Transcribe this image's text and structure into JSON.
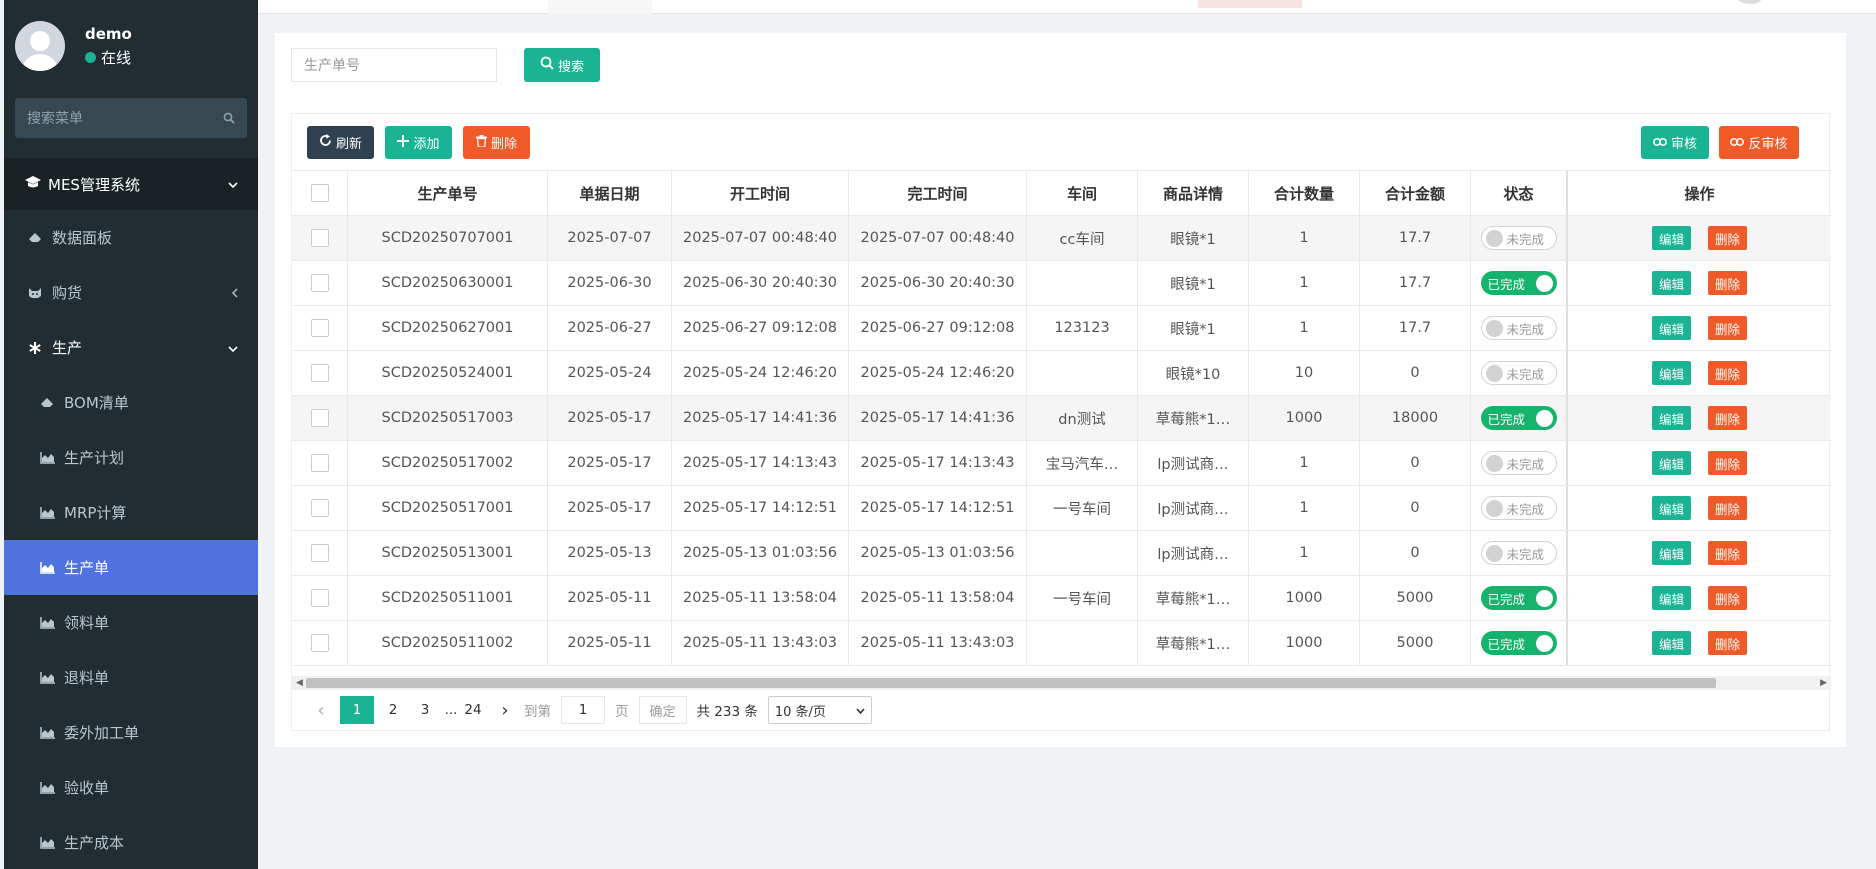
{
  "user": {
    "name": "demo",
    "status": "在线"
  },
  "sidebar": {
    "search_placeholder": "搜索菜单",
    "system_title": "MES管理系统",
    "items": [
      {
        "label": "数据面板",
        "icon": "eraser-icon"
      },
      {
        "label": "购货",
        "icon": "cat-icon"
      },
      {
        "label": "生产",
        "icon": "asterisk-icon"
      },
      {
        "label": "BOM清单",
        "icon": "eraser-icon"
      },
      {
        "label": "生产计划",
        "icon": "area-chart-icon"
      },
      {
        "label": "MRP计算",
        "icon": "area-chart-icon"
      },
      {
        "label": "生产单",
        "icon": "area-chart-icon"
      },
      {
        "label": "领料单",
        "icon": "area-chart-icon"
      },
      {
        "label": "退料单",
        "icon": "area-chart-icon"
      },
      {
        "label": "委外加工单",
        "icon": "area-chart-icon"
      },
      {
        "label": "验收单",
        "icon": "area-chart-icon"
      },
      {
        "label": "生产成本",
        "icon": "area-chart-icon"
      }
    ]
  },
  "search": {
    "placeholder": "生产单号",
    "button": "搜索"
  },
  "toolbar": {
    "refresh": "刷新",
    "add": "添加",
    "delete": "删除",
    "audit": "审核",
    "unaudit": "反审核"
  },
  "table": {
    "headers": [
      "生产单号",
      "单据日期",
      "开工时间",
      "完工时间",
      "车间",
      "商品详情",
      "合计数量",
      "合计金额",
      "状态",
      "操作"
    ],
    "rows": [
      {
        "no": "SCD20250707001",
        "date": "2025-07-07",
        "start": "2025-07-07 00:48:40",
        "end": "2025-07-07 00:48:40",
        "ws": "cc车间",
        "goods": "眼镜*1",
        "qty": "1",
        "amt": "17.7",
        "status": "未完成"
      },
      {
        "no": "SCD20250630001",
        "date": "2025-06-30",
        "start": "2025-06-30 20:40:30",
        "end": "2025-06-30 20:40:30",
        "ws": "",
        "goods": "眼镜*1",
        "qty": "1",
        "amt": "17.7",
        "status": "已完成"
      },
      {
        "no": "SCD20250627001",
        "date": "2025-06-27",
        "start": "2025-06-27 09:12:08",
        "end": "2025-06-27 09:12:08",
        "ws": "123123",
        "goods": "眼镜*1",
        "qty": "1",
        "amt": "17.7",
        "status": "未完成"
      },
      {
        "no": "SCD20250524001",
        "date": "2025-05-24",
        "start": "2025-05-24 12:46:20",
        "end": "2025-05-24 12:46:20",
        "ws": "",
        "goods": "眼镜*10",
        "qty": "10",
        "amt": "0",
        "status": "未完成"
      },
      {
        "no": "SCD20250517003",
        "date": "2025-05-17",
        "start": "2025-05-17 14:41:36",
        "end": "2025-05-17 14:41:36",
        "ws": "dn测试",
        "goods": "草莓熊*1…",
        "qty": "1000",
        "amt": "18000",
        "status": "已完成"
      },
      {
        "no": "SCD20250517002",
        "date": "2025-05-17",
        "start": "2025-05-17 14:13:43",
        "end": "2025-05-17 14:13:43",
        "ws": "宝马汽车…",
        "goods": "lp测试商…",
        "qty": "1",
        "amt": "0",
        "status": "未完成"
      },
      {
        "no": "SCD20250517001",
        "date": "2025-05-17",
        "start": "2025-05-17 14:12:51",
        "end": "2025-05-17 14:12:51",
        "ws": "一号车间",
        "goods": "lp测试商…",
        "qty": "1",
        "amt": "0",
        "status": "未完成"
      },
      {
        "no": "SCD20250513001",
        "date": "2025-05-13",
        "start": "2025-05-13 01:03:56",
        "end": "2025-05-13 01:03:56",
        "ws": "",
        "goods": "lp测试商…",
        "qty": "1",
        "amt": "0",
        "status": "未完成"
      },
      {
        "no": "SCD20250511001",
        "date": "2025-05-11",
        "start": "2025-05-11 13:58:04",
        "end": "2025-05-11 13:58:04",
        "ws": "一号车间",
        "goods": "草莓熊*1…",
        "qty": "1000",
        "amt": "5000",
        "status": "已完成"
      },
      {
        "no": "SCD20250511002",
        "date": "2025-05-11",
        "start": "2025-05-11 13:43:03",
        "end": "2025-05-11 13:43:03",
        "ws": "",
        "goods": "草莓熊*1…",
        "qty": "1000",
        "amt": "5000",
        "status": "已完成"
      }
    ],
    "edit_label": "编辑",
    "remove_label": "删除"
  },
  "pager": {
    "pages": [
      "1",
      "2",
      "3",
      "...",
      "24"
    ],
    "goto_prefix": "到第",
    "goto_value": "1",
    "goto_suffix": "页",
    "confirm": "确定",
    "total": "共 233 条",
    "page_size": "10 条/页"
  },
  "colors": {
    "primary": "#1ab394",
    "danger": "#f05a28",
    "sidebar": "#222d32",
    "active": "#4e73df",
    "dark_button": "#2f4050"
  }
}
